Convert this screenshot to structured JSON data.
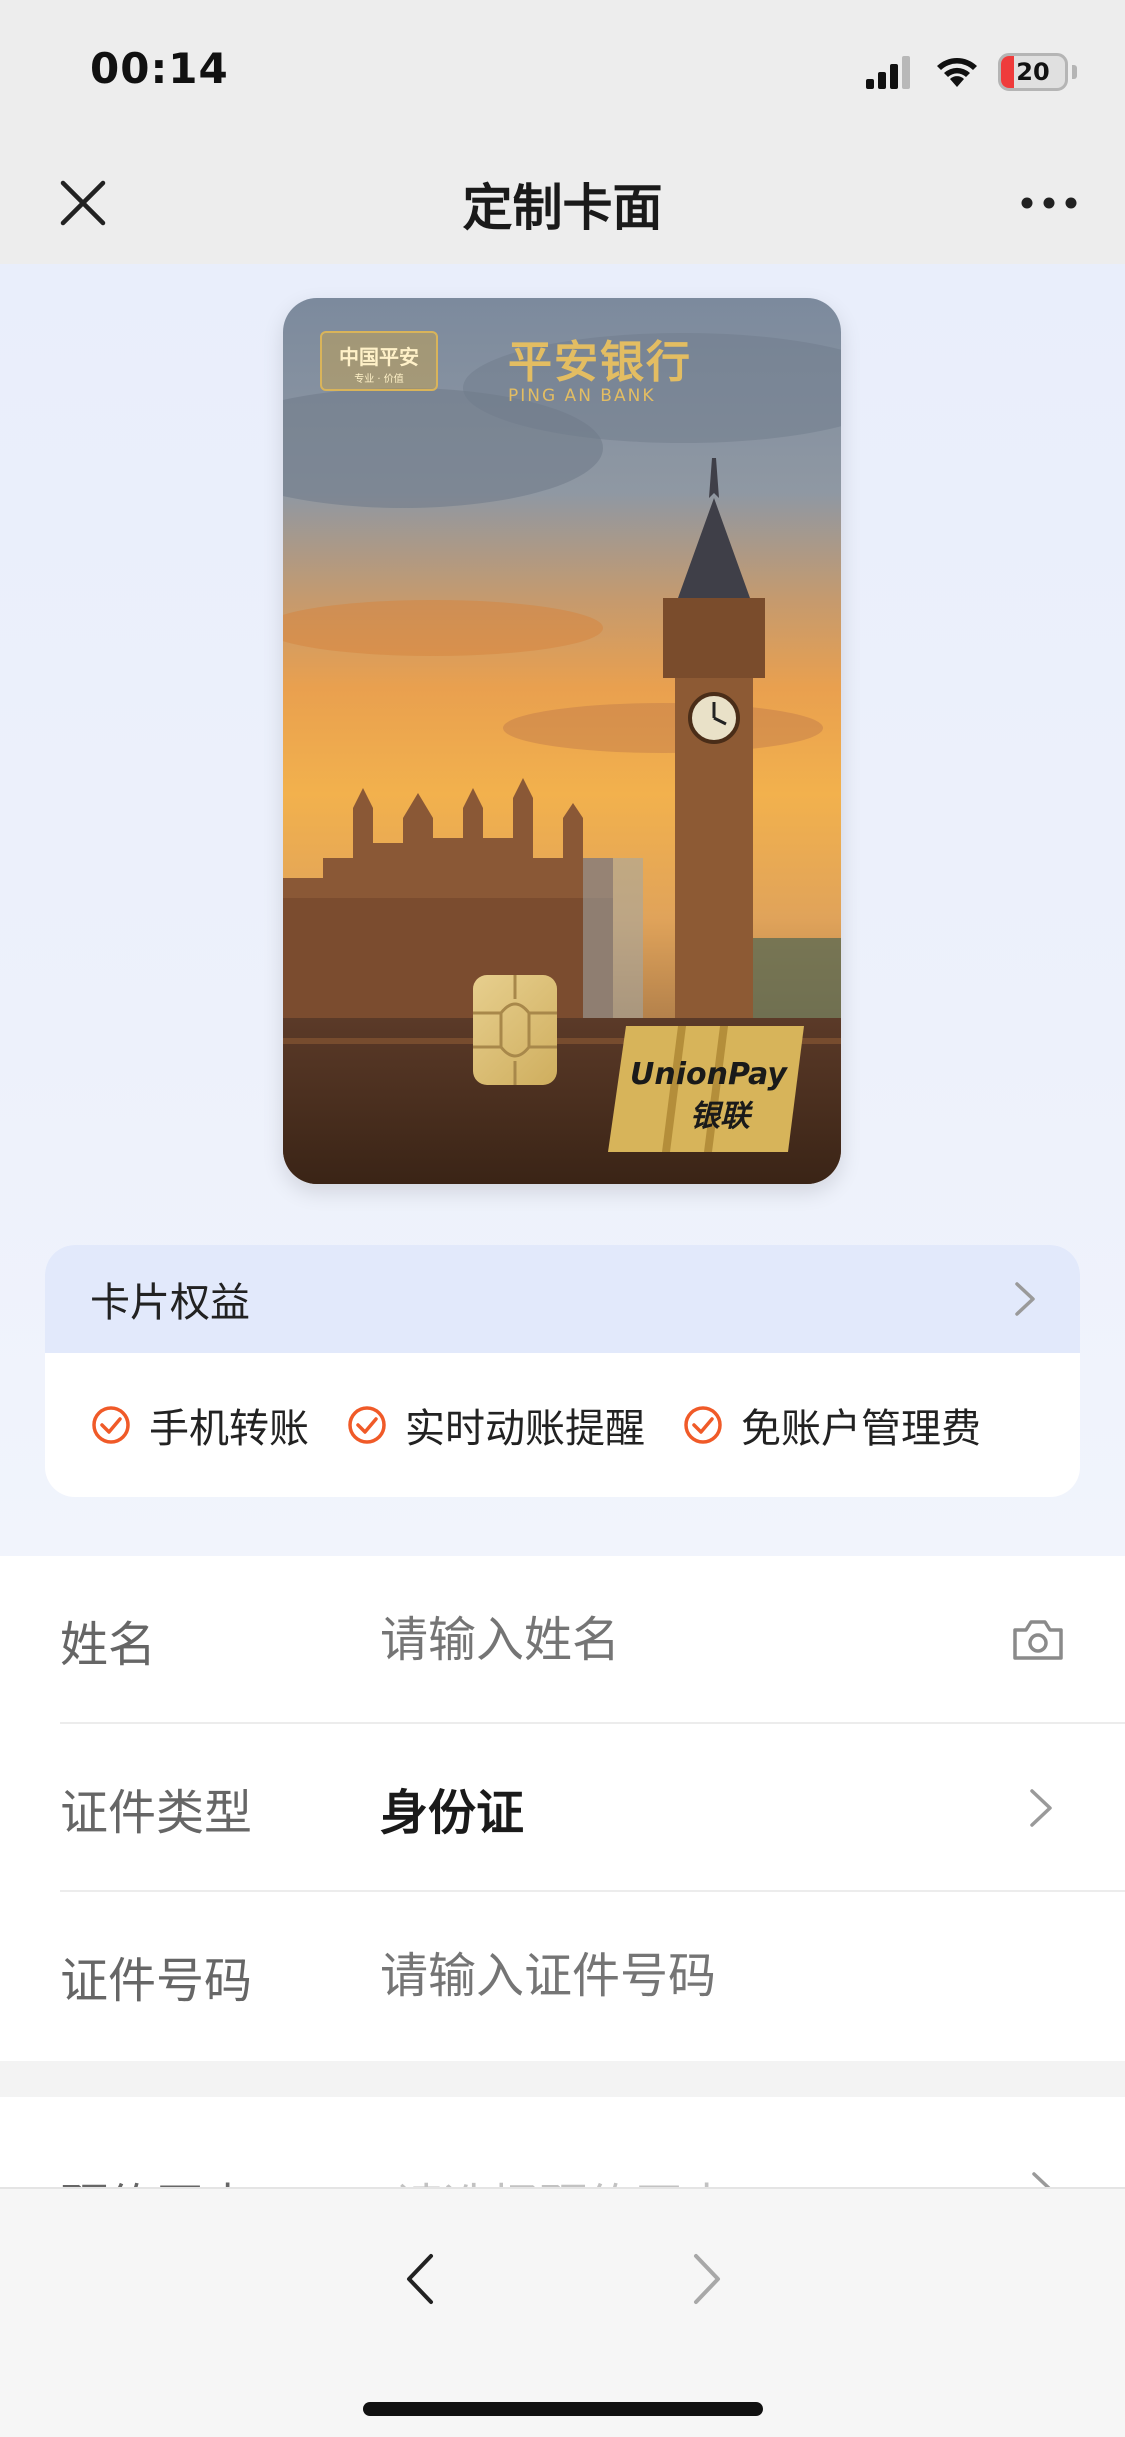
{
  "status_bar": {
    "time": "00:14",
    "battery_level": "20",
    "battery_fraction": 0.2,
    "battery_color": "#ef3b3b",
    "icons": [
      "signal-icon",
      "wifi-icon",
      "battery-icon"
    ]
  },
  "nav": {
    "title": "定制卡面",
    "close_icon": "close-icon",
    "more_icon": "more-icon"
  },
  "card": {
    "issuer_logo_text": "中国平安",
    "issuer_logo_subtext": "专业 · 价值",
    "bank_name_zh": "平安银行",
    "bank_name_en": "PING AN BANK",
    "network_name_en": "UnionPay",
    "network_name_zh": "银联",
    "image_subject": "big-ben-sunset"
  },
  "benefits": {
    "title": "卡片权益",
    "items": [
      "手机转账",
      "实时动账提醒",
      "免账户管理费"
    ],
    "accent_color": "#f05a28"
  },
  "form": {
    "name": {
      "label": "姓名",
      "placeholder": "请输入姓名"
    },
    "id_type": {
      "label": "证件类型",
      "value": "身份证"
    },
    "id_number": {
      "label": "证件号码",
      "placeholder": "请输入证件号码"
    },
    "branch": {
      "label": "预约网点",
      "placeholder": "请选择预约网点"
    }
  },
  "bottom_nav": {
    "back_icon": "back-arrow-icon",
    "forward_icon": "forward-arrow-icon"
  }
}
